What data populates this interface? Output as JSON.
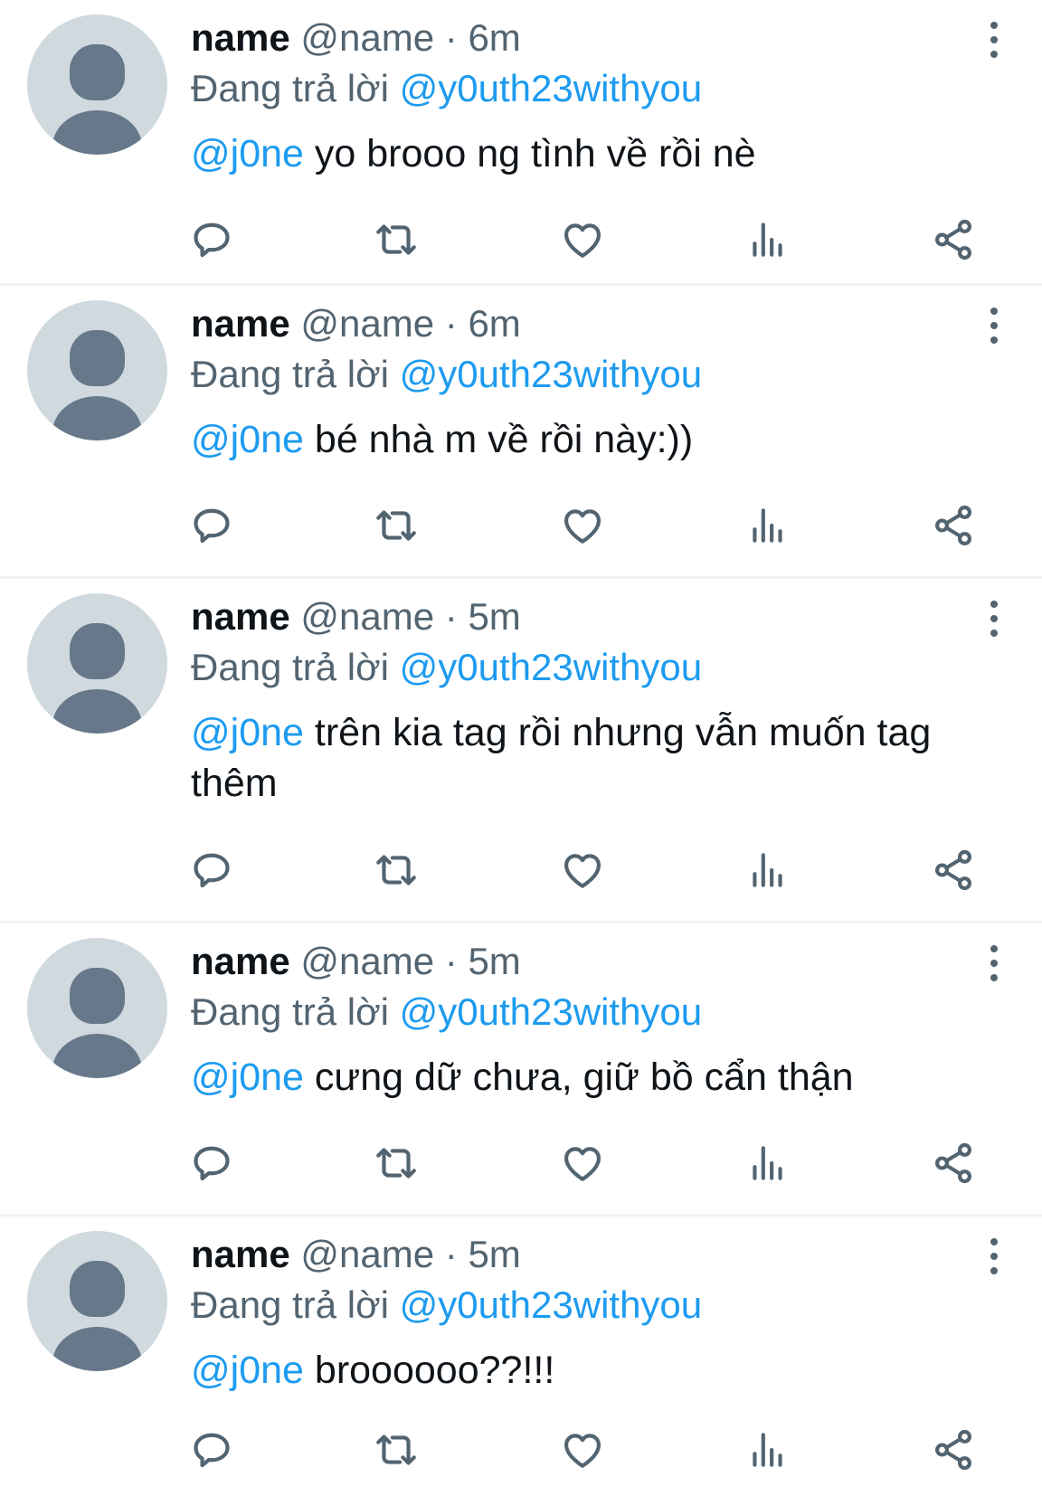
{
  "colors": {
    "accent": "#1d9bf0",
    "secondary_text": "#536471",
    "primary_text": "#0f1419",
    "avatar_bg": "#cfd9de",
    "avatar_fg": "#66788a",
    "divider": "#eff3f4"
  },
  "icons": {
    "reply": "reply-icon",
    "retweet": "retweet-icon",
    "like": "heart-icon",
    "views": "views-icon",
    "share": "share-icon",
    "more": "more-vertical-icon"
  },
  "tweets": [
    {
      "display_name": "name",
      "handle": "@name",
      "separator": "·",
      "time": "6m",
      "replying_prefix": "Đang trả lời",
      "replying_to": "@y0uth23withyou",
      "mention": "@j0ne",
      "text": "yo brooo ng tình về rồi nè"
    },
    {
      "display_name": "name",
      "handle": "@name",
      "separator": "·",
      "time": "6m",
      "replying_prefix": "Đang trả lời",
      "replying_to": "@y0uth23withyou",
      "mention": "@j0ne",
      "text": "bé nhà m về rồi này:))"
    },
    {
      "display_name": "name",
      "handle": "@name",
      "separator": "·",
      "time": "5m",
      "replying_prefix": "Đang trả lời",
      "replying_to": "@y0uth23withyou",
      "mention": "@j0ne",
      "text": "trên kia tag rồi nhưng vẫn muốn tag thêm"
    },
    {
      "display_name": "name",
      "handle": "@name",
      "separator": "·",
      "time": "5m",
      "replying_prefix": "Đang trả lời",
      "replying_to": "@y0uth23withyou",
      "mention": "@j0ne",
      "text": "cưng dữ chưa, giữ bồ cẩn thận"
    },
    {
      "display_name": "name",
      "handle": "@name",
      "separator": "·",
      "time": "5m",
      "replying_prefix": "Đang trả lời",
      "replying_to": "@y0uth23withyou",
      "mention": "@j0ne",
      "text": "broooooo??!!!"
    }
  ]
}
